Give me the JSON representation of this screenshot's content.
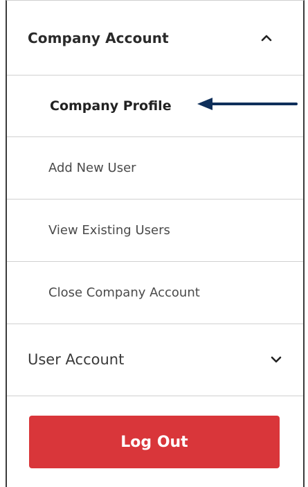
{
  "company_account": {
    "title": "Company Account",
    "chevron_icon": "chevron-up-icon",
    "items": [
      {
        "label": "Company Profile",
        "active": true
      },
      {
        "label": "Add New User",
        "active": false
      },
      {
        "label": "View Existing Users",
        "active": false
      },
      {
        "label": "Close Company Account",
        "active": false
      }
    ]
  },
  "annotation_arrow_icon": "left-arrow-icon",
  "user_account": {
    "title": "User Account",
    "chevron_icon": "chevron-down-icon"
  },
  "logout": {
    "label": "Log Out",
    "color": "#d9363a"
  },
  "colors": {
    "arrow": "#0f2f5a"
  }
}
